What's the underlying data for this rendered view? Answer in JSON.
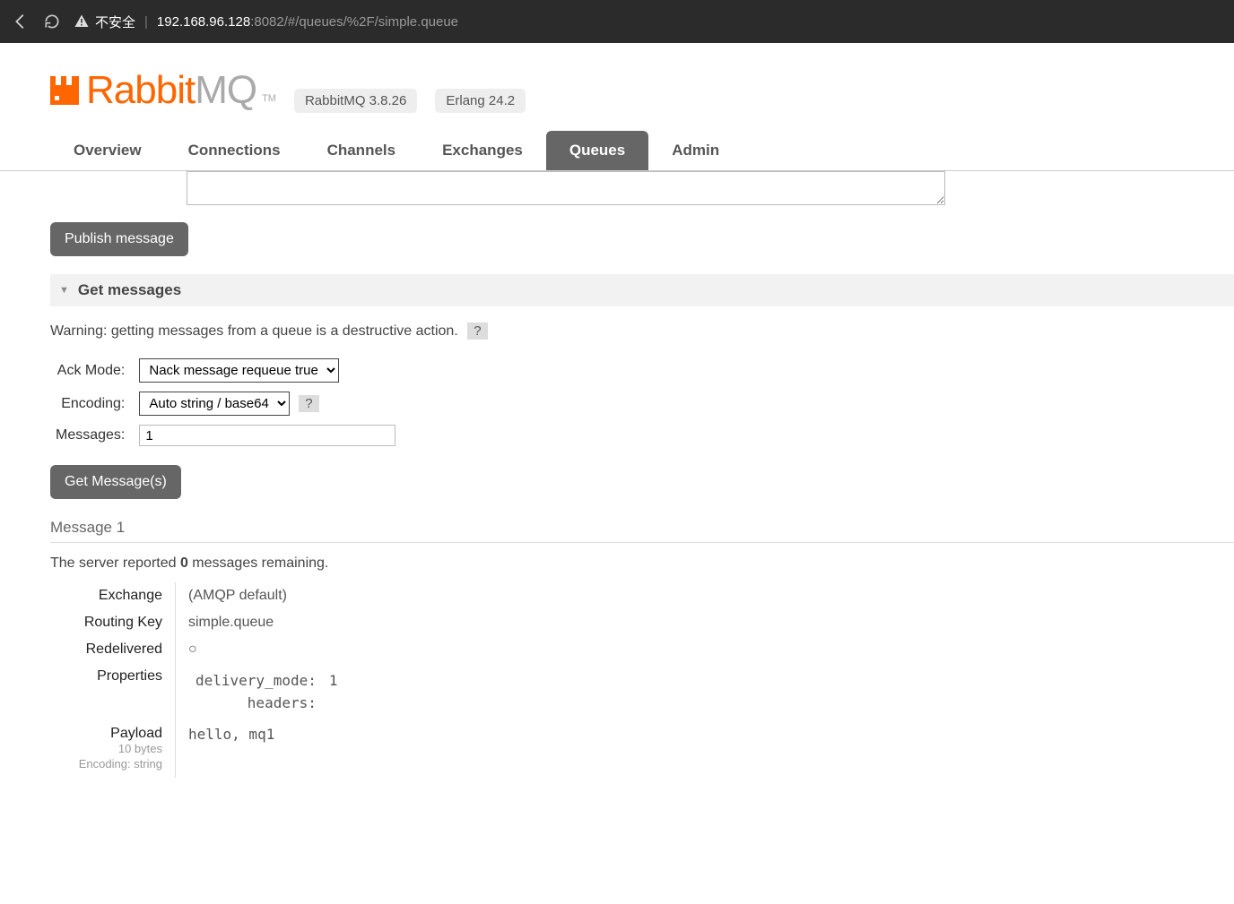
{
  "browser": {
    "insecure_label": "不安全",
    "url_host": "192.168.96.128",
    "url_rest": ":8082/#/queues/%2F/simple.queue"
  },
  "header": {
    "logo_rabbit": "Rabbit",
    "logo_mq": "MQ",
    "tm": "TM",
    "version_badge": "RabbitMQ 3.8.26",
    "erlang_badge": "Erlang 24.2"
  },
  "tabs": {
    "overview": "Overview",
    "connections": "Connections",
    "channels": "Channels",
    "exchanges": "Exchanges",
    "queues": "Queues",
    "admin": "Admin"
  },
  "publish": {
    "button": "Publish message",
    "payload_value": ""
  },
  "get": {
    "section_title": "Get messages",
    "warning": "Warning: getting messages from a queue is a destructive action.",
    "help": "?",
    "ack_label": "Ack Mode:",
    "ack_value": "Nack message requeue true",
    "encoding_label": "Encoding:",
    "encoding_value": "Auto string / base64",
    "messages_label": "Messages:",
    "messages_value": "1",
    "button": "Get Message(s)"
  },
  "result": {
    "title": "Message 1",
    "remaining_pre": "The server reported ",
    "remaining_count": "0",
    "remaining_post": " messages remaining.",
    "rows": {
      "exchange_label": "Exchange",
      "exchange_value": "(AMQP default)",
      "routing_label": "Routing Key",
      "routing_value": "simple.queue",
      "redelivered_label": "Redelivered",
      "redelivered_value": "○",
      "properties_label": "Properties",
      "properties": {
        "delivery_mode_key": "delivery_mode:",
        "delivery_mode_val": "1",
        "headers_key": "headers:",
        "headers_val": ""
      },
      "payload_label": "Payload",
      "payload_bytes": "10 bytes",
      "payload_encoding": "Encoding: string",
      "payload_value": "hello, mq1"
    }
  }
}
